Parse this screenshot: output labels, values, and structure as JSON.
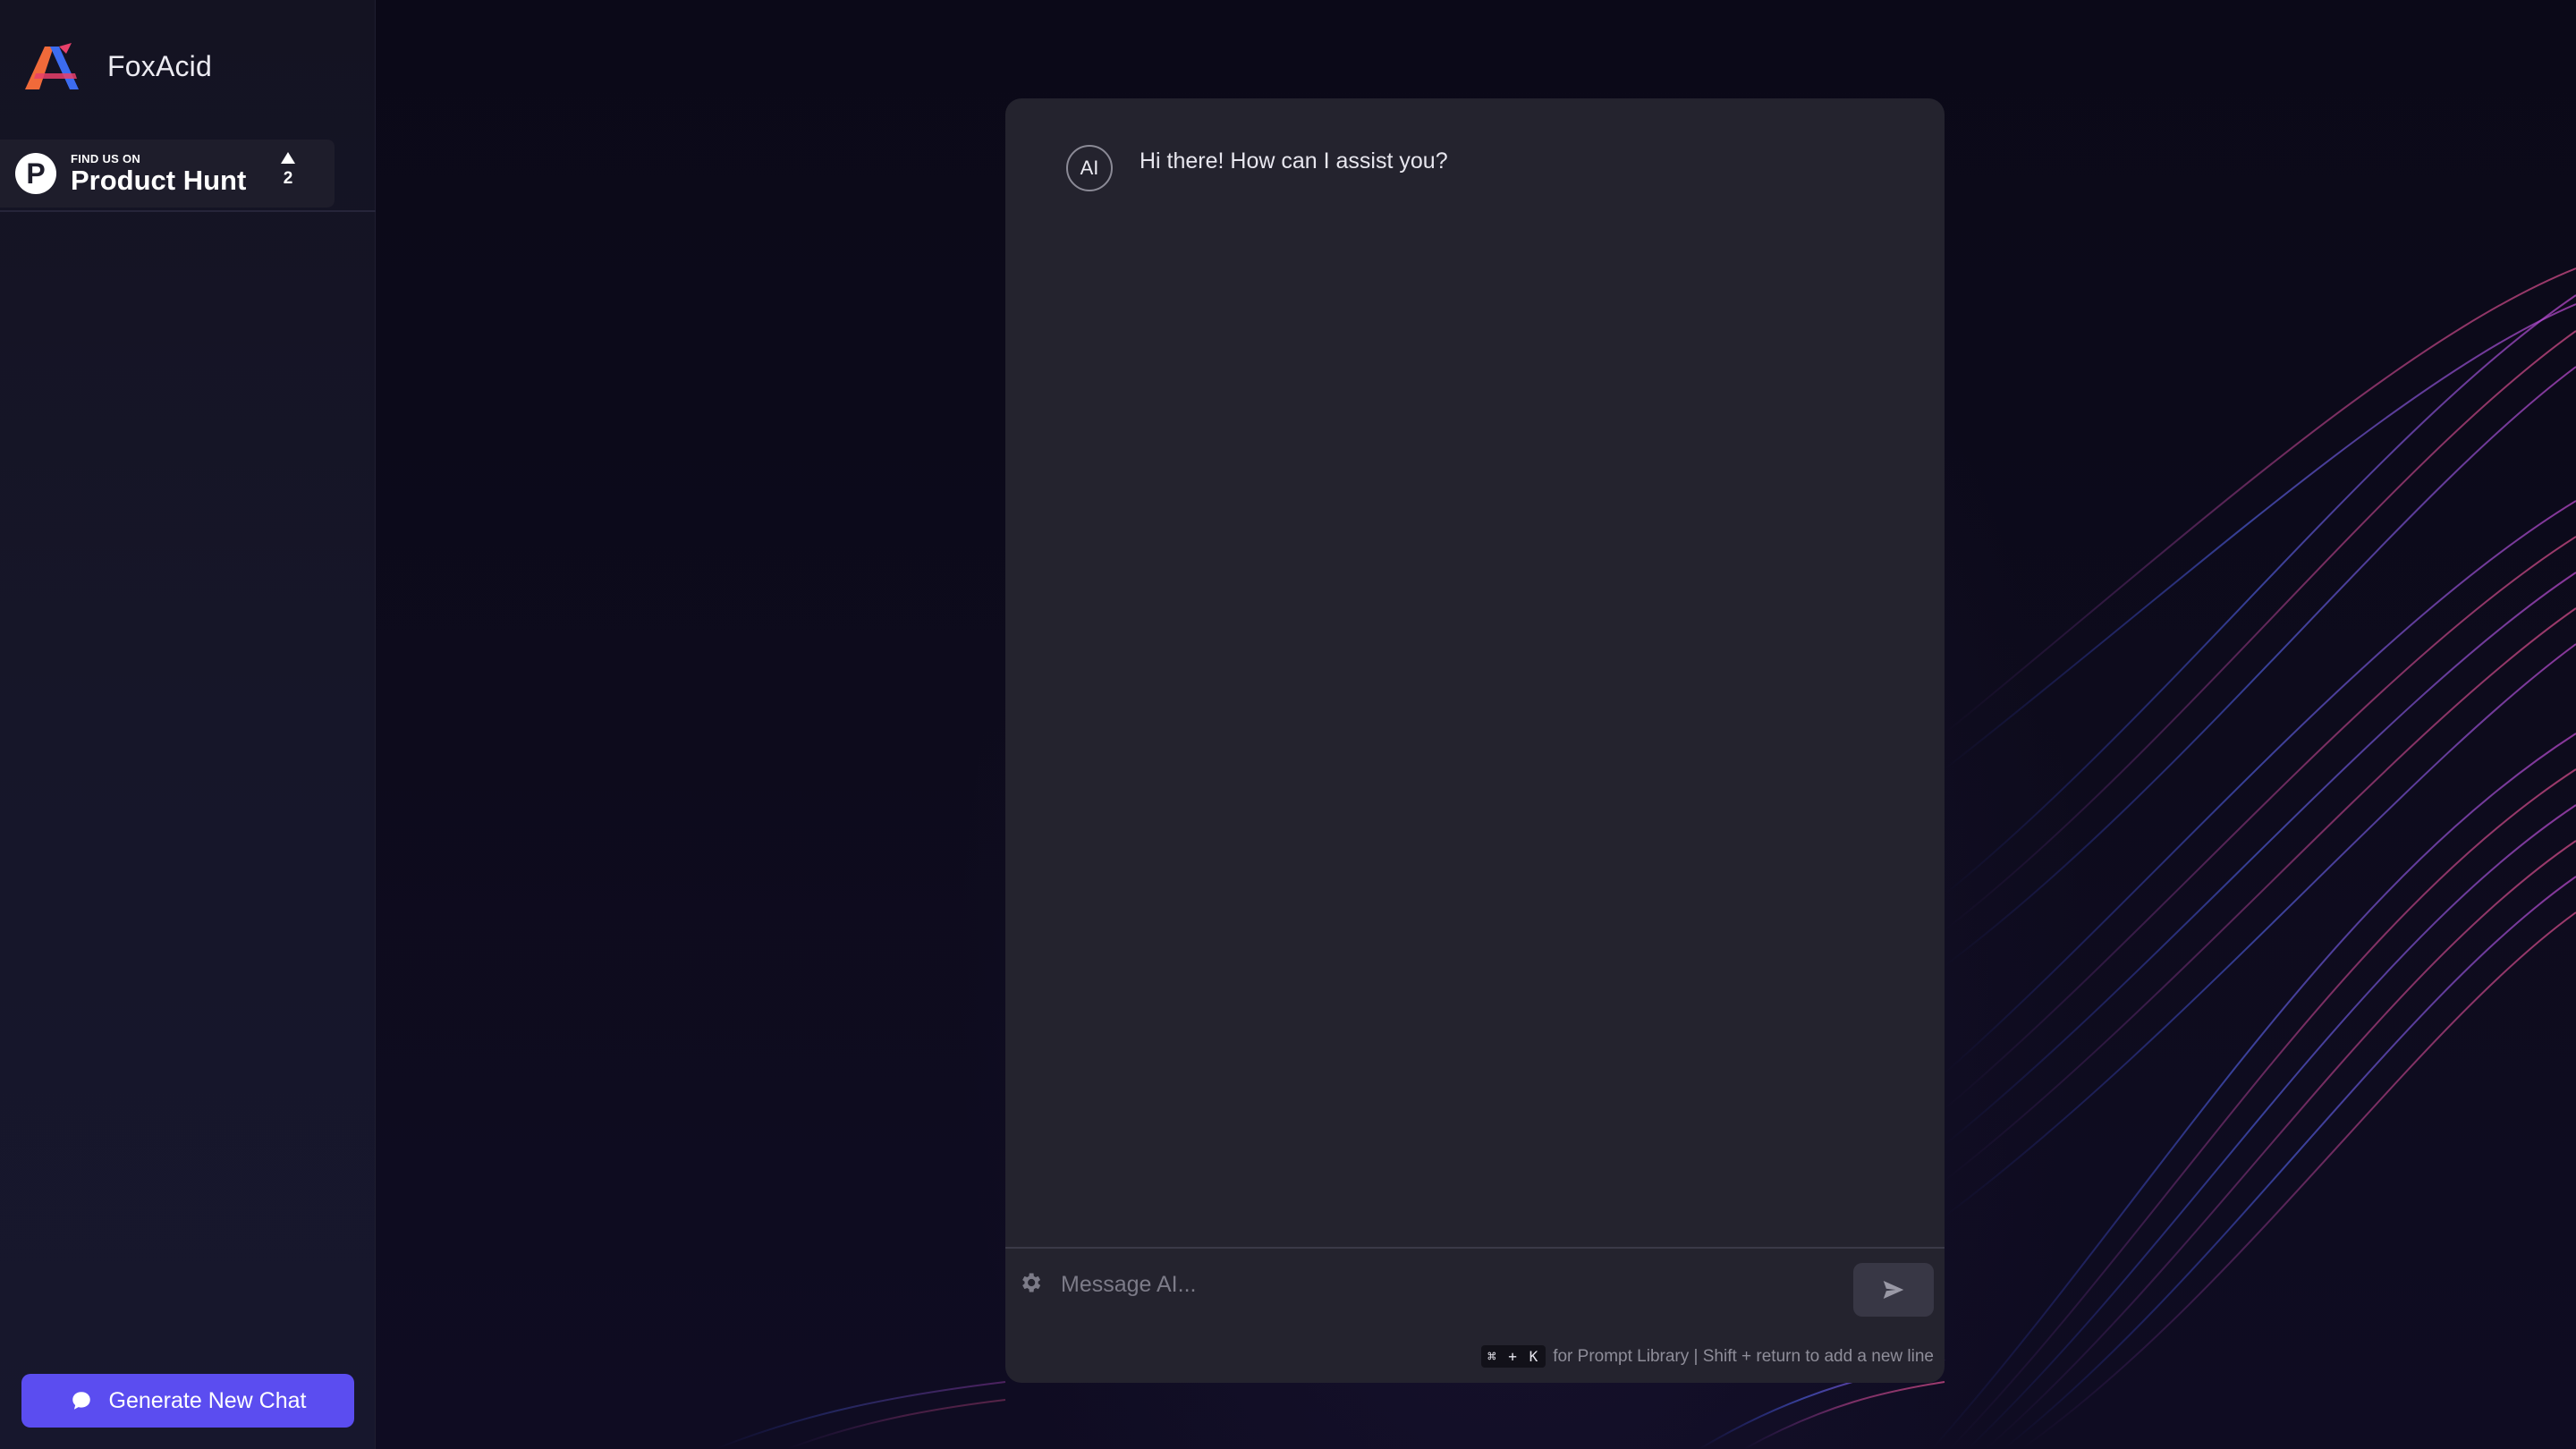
{
  "app": {
    "name": "FoxAcid"
  },
  "product_hunt": {
    "small": "FIND US ON",
    "big": "Product Hunt",
    "count": "2"
  },
  "sidebar": {
    "new_chat_label": "Generate New Chat"
  },
  "chat": {
    "messages": [
      {
        "sender": "AI",
        "text": "Hi there! How can I assist you?"
      }
    ],
    "input": {
      "placeholder": "Message AI...",
      "value": ""
    },
    "hint": {
      "kbd": "⌘ + K",
      "text": "for Prompt Library | Shift + return to add a new line"
    }
  },
  "colors": {
    "accent": "#5b4df0",
    "panel": "#24232e",
    "sidebar": "#161629"
  },
  "icons": [
    "foxacid-logo-icon",
    "product-hunt-logo-icon",
    "upvote-arrow-icon",
    "chat-bubble-icon",
    "settings-icon",
    "send-icon"
  ]
}
